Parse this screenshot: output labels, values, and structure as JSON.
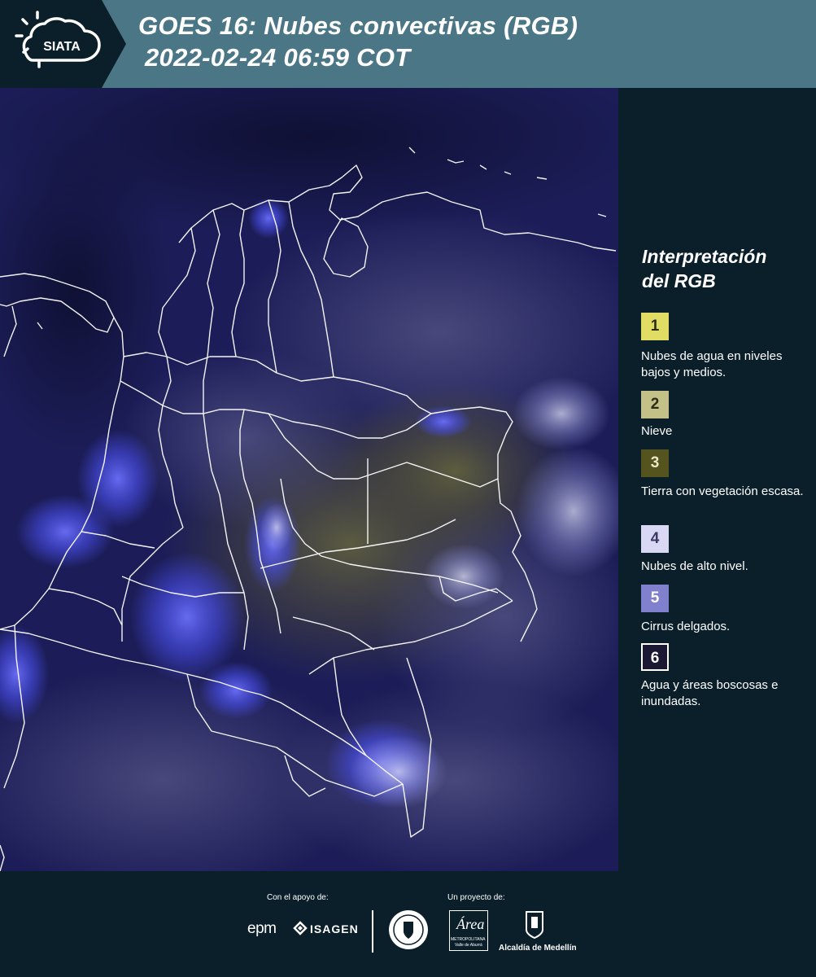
{
  "header": {
    "logo_text": "SIATA",
    "title_line1": "GOES 16: Nubes convectivas (RGB)",
    "title_line2": "2022-02-24 06:59 COT"
  },
  "legend": {
    "title_line1": "Interpretación",
    "title_line2": "del RGB",
    "items": [
      {
        "number": "1",
        "label": "Nubes de agua en niveles bajos y medios.",
        "color": "#e0dc64",
        "text_color": "#2b2b16"
      },
      {
        "number": "2",
        "label": "Nieve",
        "color": "#c4c188",
        "text_color": "#2b2b16"
      },
      {
        "number": "3",
        "label": "Tierra con vegetación escasa.",
        "color": "#55531e",
        "text_color": "#e9e8c6"
      },
      {
        "number": "4",
        "label": "Nubes de alto nivel.",
        "color": "#d8d8f4",
        "text_color": "#3a3a66"
      },
      {
        "number": "5",
        "label": "Cirrus delgados.",
        "color": "#8180cf",
        "text_color": "#ffffff"
      },
      {
        "number": "6",
        "label": "Agua y áreas boscosas e inundadas.",
        "color": "#1a1833",
        "text_color": "#ffffff"
      }
    ]
  },
  "footer": {
    "support_label": "Con el apoyo de:",
    "project_label": "Un proyecto de:",
    "sponsors": [
      "epm",
      "ISAGEN"
    ],
    "partner_area_name": "Área",
    "partner_area_sub1": "METROPOLITANA",
    "partner_area_sub2": "Valle de Aburrá",
    "partner_city": "Alcaldía de Medellín"
  },
  "colors": {
    "header_bg": "#4b7686",
    "logo_bg": "#0b1f2b",
    "page_bg": "#0b1f2b",
    "map_base": "#1a1b55",
    "convective": "#4a50f0",
    "boundary": "#ffffff"
  }
}
